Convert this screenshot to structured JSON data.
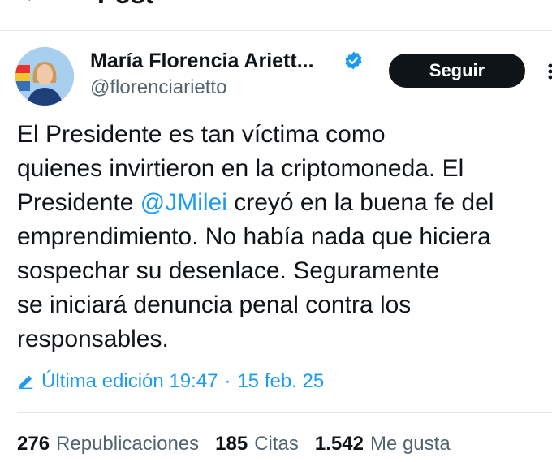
{
  "header": {
    "title": "Post",
    "back_icon": "arrow-left-icon"
  },
  "author": {
    "name": "María Florencia Ariett...",
    "handle": "@florenciarietto",
    "verified": true,
    "verified_color": "#1d9bf0",
    "follow_label": "Seguir"
  },
  "tweet": {
    "lines": [
      "El Presidente es tan víctima como",
      "quienes invirtieron en la criptomoneda. El",
      "Presidente ",
      "emprendimiento. No había nada que hiciera",
      "sospechar su desenlace. Seguramente",
      "se iniciará denuncia penal contra los",
      "responsables."
    ],
    "mention": "@JMilei",
    "after_mention": " creyó en la buena fe del"
  },
  "edit_info": {
    "label": "Última edición 19:47",
    "separator": "·",
    "date": "15 feb. 25"
  },
  "stats": {
    "reposts_count": "276",
    "reposts_label": "Republicaciones",
    "quotes_count": "185",
    "quotes_label": "Citas",
    "likes_count": "1.542",
    "likes_label": "Me gusta"
  },
  "colors": {
    "accent": "#1d9bf0",
    "text": "#0f1419",
    "muted": "#536471",
    "button_bg": "#0f1419"
  }
}
